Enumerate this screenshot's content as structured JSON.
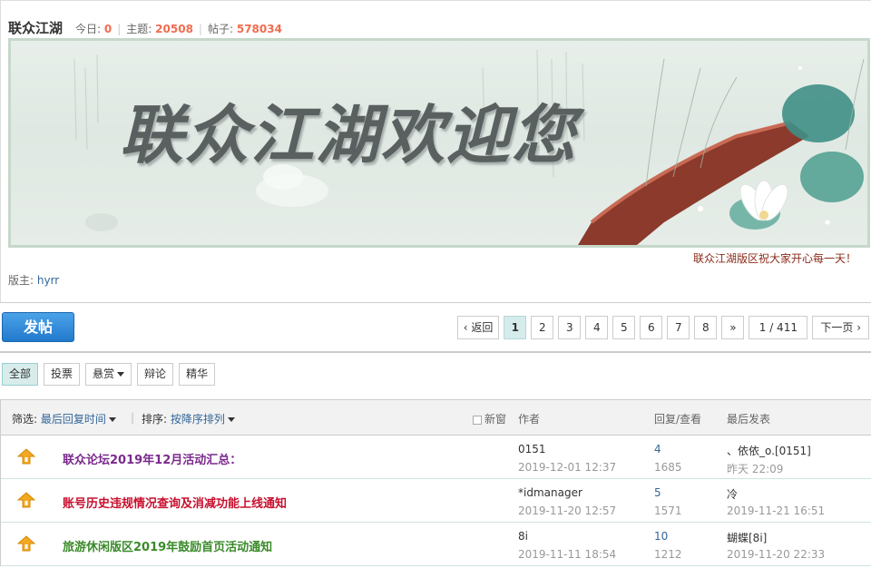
{
  "forum": {
    "title": "联众江湖",
    "today_label": "今日:",
    "today_value": "0",
    "topics_label": "主题:",
    "topics_value": "20508",
    "posts_label": "帖子:",
    "posts_value": "578034",
    "banner_text": "联众江湖欢迎您",
    "greeting": "联众江湖版区祝大家开心每一天！",
    "moderator_label": "版主:",
    "moderator_name": "hyrr"
  },
  "actions": {
    "post_label": "发帖"
  },
  "pager": {
    "back_label": "返回",
    "pages": [
      "1",
      "2",
      "3",
      "4",
      "5",
      "6",
      "7",
      "8"
    ],
    "current": "1",
    "next_arrow": "»",
    "input_value": "1",
    "total": "/ 411",
    "next_label": "下一页"
  },
  "tabs": [
    "全部",
    "投票",
    "悬赏",
    "辩论",
    "精华"
  ],
  "table": {
    "filter_label": "筛选:",
    "filter_value": "最后回复时间",
    "sort_label": "排序:",
    "sort_value": "按降序排列",
    "new_window_label": "新窗",
    "author_header": "作者",
    "replies_header": "回复/查看",
    "last_post_header": "最后发表"
  },
  "threads": [
    {
      "title": "联众论坛2019年12月活动汇总：",
      "title_color": "#7a2a8c",
      "author": "0151",
      "created": "2019-12-01 12:37",
      "replies": "4",
      "views": "1685",
      "last_user": "、依依_o.[0151]",
      "last_time": "昨天 22:09"
    },
    {
      "title": "账号历史违规情况查询及消减功能上线通知",
      "title_color": "#c8102e",
      "author": "*idmanager",
      "created": "2019-11-20 12:57",
      "replies": "5",
      "views": "1571",
      "last_user": "冷",
      "last_time": "2019-11-21 16:51"
    },
    {
      "title": "旅游休闲版区2019年鼓励首页活动通知",
      "title_color": "#3a8a2a",
      "author": "8i",
      "created": "2019-11-11 18:54",
      "replies": "10",
      "views": "1212",
      "last_user": "蝴蝶[8i]",
      "last_time": "2019-11-20 22:33"
    }
  ],
  "colors": {
    "accent": "#2279cd",
    "stat_number": "#f26c4f",
    "link": "#336699"
  }
}
